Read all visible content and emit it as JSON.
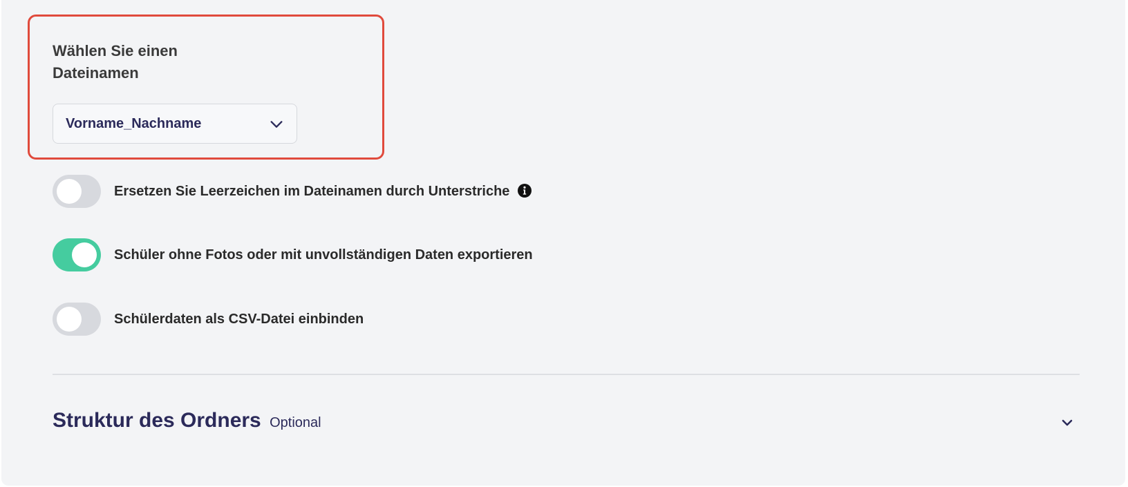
{
  "filename": {
    "label_line1": "Wählen Sie einen",
    "label_line2": "Dateinamen",
    "selected_value": "Vorname_Nachname"
  },
  "toggles": [
    {
      "label": "Ersetzen Sie Leerzeichen im Dateinamen durch Unterstriche",
      "on": false,
      "icon": "info-icon"
    },
    {
      "label": "Schüler ohne Fotos oder mit unvollständigen Daten exportieren",
      "on": true
    },
    {
      "label": "Schülerdaten als CSV-Datei einbinden",
      "on": false
    }
  ],
  "folder_section": {
    "title": "Struktur des Ordners",
    "optional": "Optional"
  },
  "colors": {
    "highlight": "#e04a3c",
    "toggle_on": "#45cc9f",
    "toggle_off": "#d7d9de",
    "text_dark_blue": "#2b2a5a"
  }
}
